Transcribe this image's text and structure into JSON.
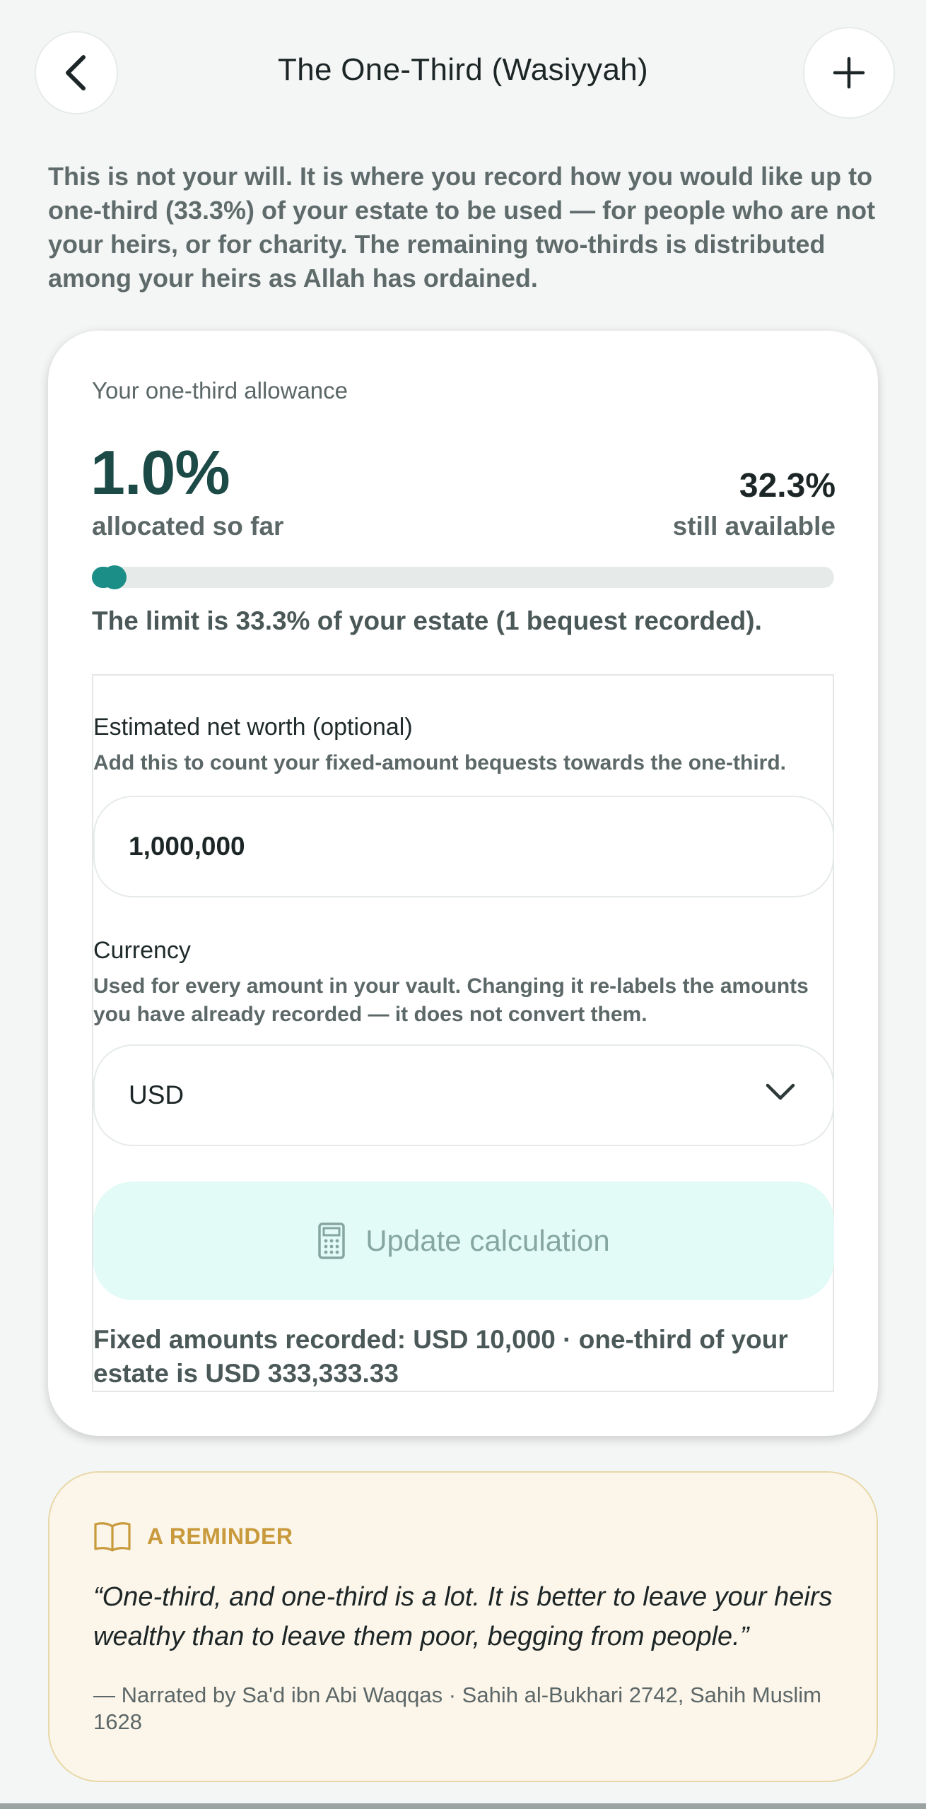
{
  "header": {
    "title": "The One-Third (Wasiyyah)",
    "back_icon": "chevron-left-icon",
    "add_icon": "plus-icon"
  },
  "intro": "This is not your will. It is where you record how you would like up to one-third (33.3%) of your estate to be used — for people who are not your heirs, or for charity. The remaining two-thirds is distributed among your heirs as Allah has ordained.",
  "allowance": {
    "label": "Your one-third allowance",
    "allocated_pct": "1.0%",
    "allocated_label": "allocated so far",
    "available_pct": "32.3%",
    "available_label": "still available",
    "progress_fraction": 0.03,
    "limit_text": "The limit is 33.3% of your estate (1 bequest recorded)."
  },
  "net_worth": {
    "label": "Estimated net worth (optional)",
    "help": "Add this to count your fixed-amount bequests towards the one-third.",
    "value": "1,000,000"
  },
  "currency": {
    "label": "Currency",
    "help": "Used for every amount in your vault. Changing it re-labels the amounts you have already recorded — it does not convert them.",
    "selected": "USD"
  },
  "update_button": {
    "label": "Update calculation",
    "icon": "calculator-icon"
  },
  "summary": "Fixed amounts recorded: USD 10,000 · one-third of your estate is USD 333,333.33",
  "reminder": {
    "icon": "book-open-icon",
    "title": "A REMINDER",
    "quote": "“One-third, and one-third is a lot. It is better to leave your heirs wealthy than to leave them poor, begging from people.”",
    "citation": "— Narrated by Sa'd ibn Abi Waqqas · Sahih al-Bukhari 2742, Sahih Muslim 1628"
  },
  "colors": {
    "accent": "#1b8f87",
    "primary_text": "#1c4a47",
    "reminder_gold": "#c89a3c",
    "button_bg": "#e3fbf6"
  }
}
